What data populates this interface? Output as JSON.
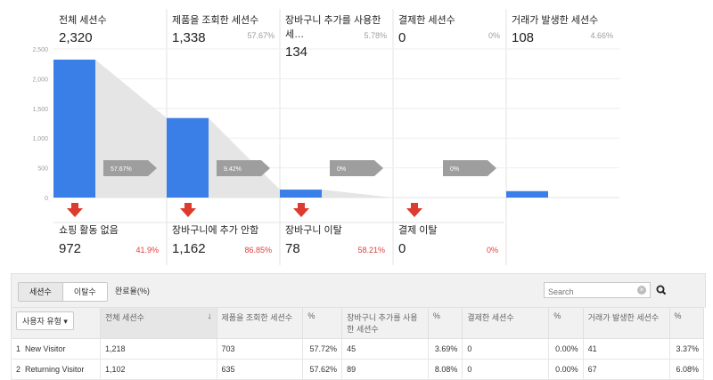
{
  "chart_data": {
    "type": "bar",
    "categories": [
      "전체 세션수",
      "제품을 조회한 세션수",
      "장바구니 추가를 사용한 세…",
      "결제한 세션수",
      "거래가 발생한 세션수"
    ],
    "values": [
      2320,
      1338,
      134,
      0,
      108
    ],
    "ylim": [
      0,
      2500
    ],
    "yticks": [
      "2,500",
      "2,000",
      "1,500",
      "1,000",
      "500",
      "0"
    ],
    "yticks_values": [
      2500,
      2000,
      1500,
      1000,
      500,
      0
    ],
    "grid": true,
    "bar_color": "#3a7ee8",
    "funnel_color": "#e5e5e5",
    "arrow_color": "#9e9e9e",
    "drop_arrow_color": "#dd3b2e"
  },
  "stages": [
    {
      "label": "전체 세션수",
      "value": "2,320",
      "pct": ""
    },
    {
      "label": "제품을 조회한 세션수",
      "value": "1,338",
      "pct": "57.67%"
    },
    {
      "label": "장바구니 추가를 사용한 세…",
      "value": "134",
      "pct": "5.78%"
    },
    {
      "label": "결제한 세션수",
      "value": "0",
      "pct": "0%"
    },
    {
      "label": "거래가 발생한 세션수",
      "value": "108",
      "pct": "4.66%"
    }
  ],
  "conversion_arrows": [
    "57.67%",
    "9.42%",
    "0%",
    "0%"
  ],
  "dropoffs": [
    {
      "label": "쇼핑 활동 없음",
      "value": "972",
      "pct": "41.9%"
    },
    {
      "label": "장바구니에 추가 안함",
      "value": "1,162",
      "pct": "86.85%"
    },
    {
      "label": "장바구니 이탈",
      "value": "78",
      "pct": "58.21%"
    },
    {
      "label": "결제 이탈",
      "value": "0",
      "pct": "0%"
    }
  ],
  "controls": {
    "tab_sessions": "세션수",
    "tab_exits": "이탈수",
    "tab_completion": "완료율(%)",
    "search_placeholder": "Search"
  },
  "table": {
    "dimension_select": "사용자 유형",
    "headers": [
      "전체 세션수",
      "제품을 조회한 세션수",
      "%",
      "장바구니 추가를 사용한 세션수",
      "%",
      "결제한 세션수",
      "%",
      "거래가 발생한 세션수",
      "%"
    ],
    "rows": [
      {
        "index": "1",
        "name": "New Visitor",
        "cells": [
          "1,218",
          "703",
          "57.72%",
          "45",
          "3.69%",
          "0",
          "0.00%",
          "41",
          "3.37%"
        ]
      },
      {
        "index": "2",
        "name": "Returning Visitor",
        "cells": [
          "1,102",
          "635",
          "57.62%",
          "89",
          "8.08%",
          "0",
          "0.00%",
          "67",
          "6.08%"
        ]
      }
    ]
  }
}
